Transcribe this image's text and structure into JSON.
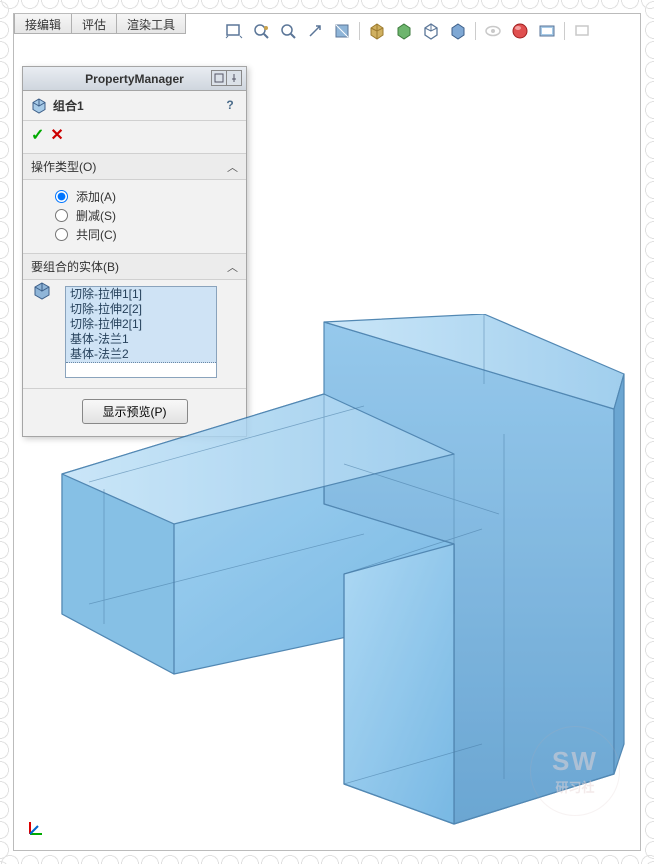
{
  "menu_tabs": {
    "t0": "接编辑",
    "t1": "评估",
    "t2": "渲染工具"
  },
  "pm": {
    "title": "PropertyManager",
    "feature_name": "组合1",
    "section_op": "操作类型(O)",
    "op_add": "添加(A)",
    "op_sub": "删减(S)",
    "op_common": "共同(C)",
    "section_bodies": "要组合的实体(B)",
    "bodies": {
      "b0": "切除-拉伸1[1]",
      "b1": "切除-拉伸2[2]",
      "b2": "切除-拉伸2[1]",
      "b3": "基体-法兰1",
      "b4": "基体-法兰2"
    },
    "preview_btn": "显示预览(P)"
  },
  "watermark": {
    "line1": "SW",
    "line2": "研习社"
  }
}
